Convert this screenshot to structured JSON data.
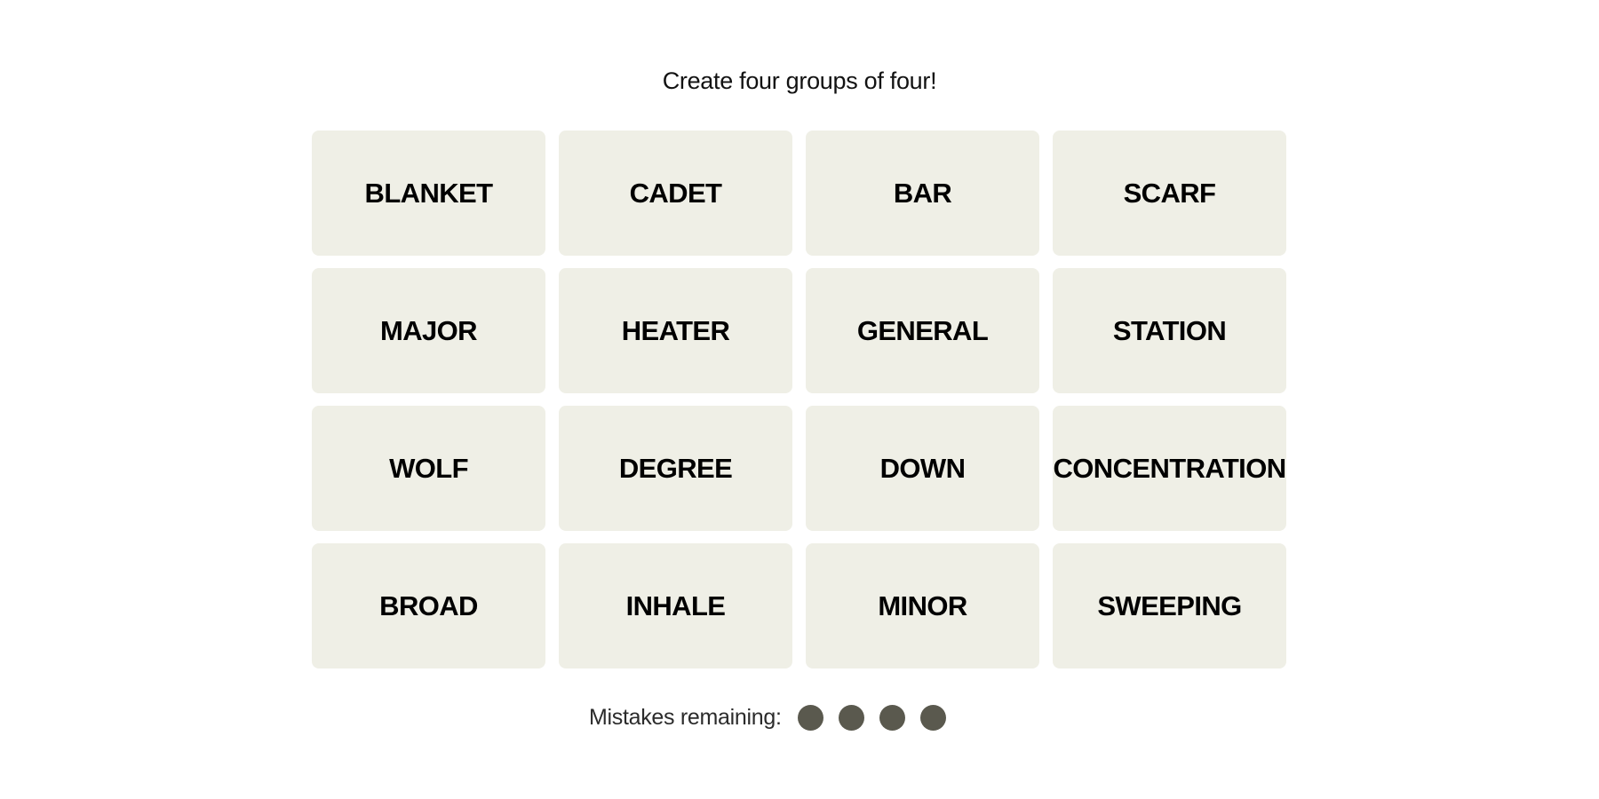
{
  "header": {
    "instructions": "Create four groups of four!"
  },
  "board": {
    "tiles": [
      {
        "label": "BLANKET"
      },
      {
        "label": "CADET"
      },
      {
        "label": "BAR"
      },
      {
        "label": "SCARF"
      },
      {
        "label": "MAJOR"
      },
      {
        "label": "HEATER"
      },
      {
        "label": "GENERAL"
      },
      {
        "label": "STATION"
      },
      {
        "label": "WOLF"
      },
      {
        "label": "DEGREE"
      },
      {
        "label": "DOWN"
      },
      {
        "label": "CONCENTRATION"
      },
      {
        "label": "BROAD"
      },
      {
        "label": "INHALE"
      },
      {
        "label": "MINOR"
      },
      {
        "label": "SWEEPING"
      }
    ]
  },
  "mistakes": {
    "label": "Mistakes remaining:",
    "remaining": 4,
    "total": 4,
    "dot_color": "#5a594e"
  },
  "colors": {
    "tile_background": "#efefe6",
    "tile_text": "#000000",
    "page_background": "#ffffff"
  }
}
